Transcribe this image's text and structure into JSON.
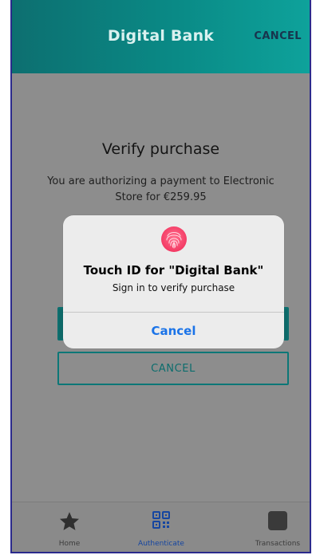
{
  "header": {
    "title": "Digital Bank",
    "cancel_label": "CANCEL"
  },
  "main": {
    "title": "Verify purchase",
    "description": "You are authorizing a payment to Electronic Store for €259.95",
    "cancel_button_label": "CANCEL"
  },
  "touch_id_dialog": {
    "title": "Touch ID for \"Digital Bank\"",
    "subtitle": "Sign in to verify purchase",
    "cancel_label": "Cancel"
  },
  "tab_bar": {
    "active": "Authenticate",
    "items": [
      {
        "label": "Home",
        "icon": "star-icon"
      },
      {
        "label": "Authenticate",
        "icon": "qr-code-icon"
      },
      {
        "label": "Transactions",
        "icon": "square-icon"
      }
    ]
  },
  "colors": {
    "header_start": "#0d6f70",
    "header_end": "#0ea29b",
    "accent": "#0c7777",
    "dialog_action": "#1a73e8",
    "active_tab": "#1646a0"
  }
}
